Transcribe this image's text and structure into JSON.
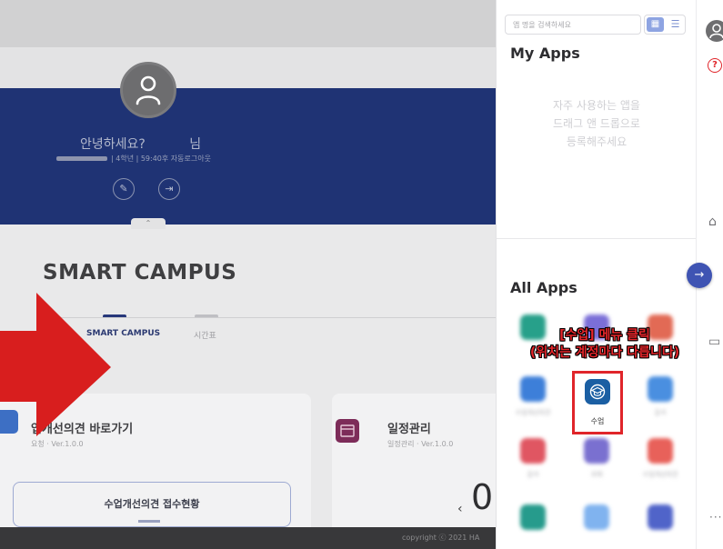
{
  "main": {
    "greeting": "안녕하세요?",
    "greeting_suffix": "님",
    "user_info": "| 4학년 | 59:40후 자동로그아웃",
    "campus_title": "SMART CAMPUS",
    "tabs": [
      {
        "label": "SMART CAMPUS",
        "active": true
      },
      {
        "label": "시간표",
        "active": false
      }
    ],
    "cards": [
      {
        "title": "업개선의견 바로가기",
        "subtitle": "요청 · Ver.1.0.0",
        "button": "수업개선의견 접수현황"
      },
      {
        "title": "일정관리",
        "subtitle": "일정관리 · Ver.1.0.0",
        "counter": "0"
      }
    ],
    "footer": "copyright ⓒ 2021 HA",
    "colors": {
      "hero": "#1f3374",
      "arrow": "#d81e1e"
    }
  },
  "drawer": {
    "search_placeholder": "앱 명을 검색하세요",
    "my_apps_title": "My Apps",
    "empty_message": [
      "자주 사용하는 앱을",
      "드래그 앤 드롭으로",
      "등록해주세요"
    ],
    "all_apps_title": "All Apps",
    "callout": [
      "[수업] 메뉴 클릭",
      "(위치는 계정마다 다릅니다)"
    ],
    "highlighted_app": {
      "label": "수업",
      "icon": "graduation-cap-icon",
      "color": "#1b5fa3"
    },
    "apps": [
      {
        "label": "",
        "color": "#27a08a"
      },
      {
        "label": "",
        "color": "#7b6fd8"
      },
      {
        "label": "",
        "color": "#e26a55"
      },
      {
        "label": "수업개선의견",
        "color": "#3d7fd9"
      },
      {
        "label": "",
        "color": "#1b5fa3"
      },
      {
        "label": "출석",
        "color": "#4a8fe0"
      },
      {
        "label": "출석",
        "color": "#e05662"
      },
      {
        "label": "과제",
        "color": "#7a70d0"
      },
      {
        "label": "수업개선의견",
        "color": "#e8615a"
      },
      {
        "label": "",
        "color": "#269b8c"
      },
      {
        "label": "",
        "color": "#80b3ef"
      },
      {
        "label": "",
        "color": "#5064c9"
      }
    ]
  },
  "rail": {
    "help_symbol": "?",
    "home_icon": "home-icon",
    "monitor_icon": "monitor-icon",
    "more": "···"
  }
}
